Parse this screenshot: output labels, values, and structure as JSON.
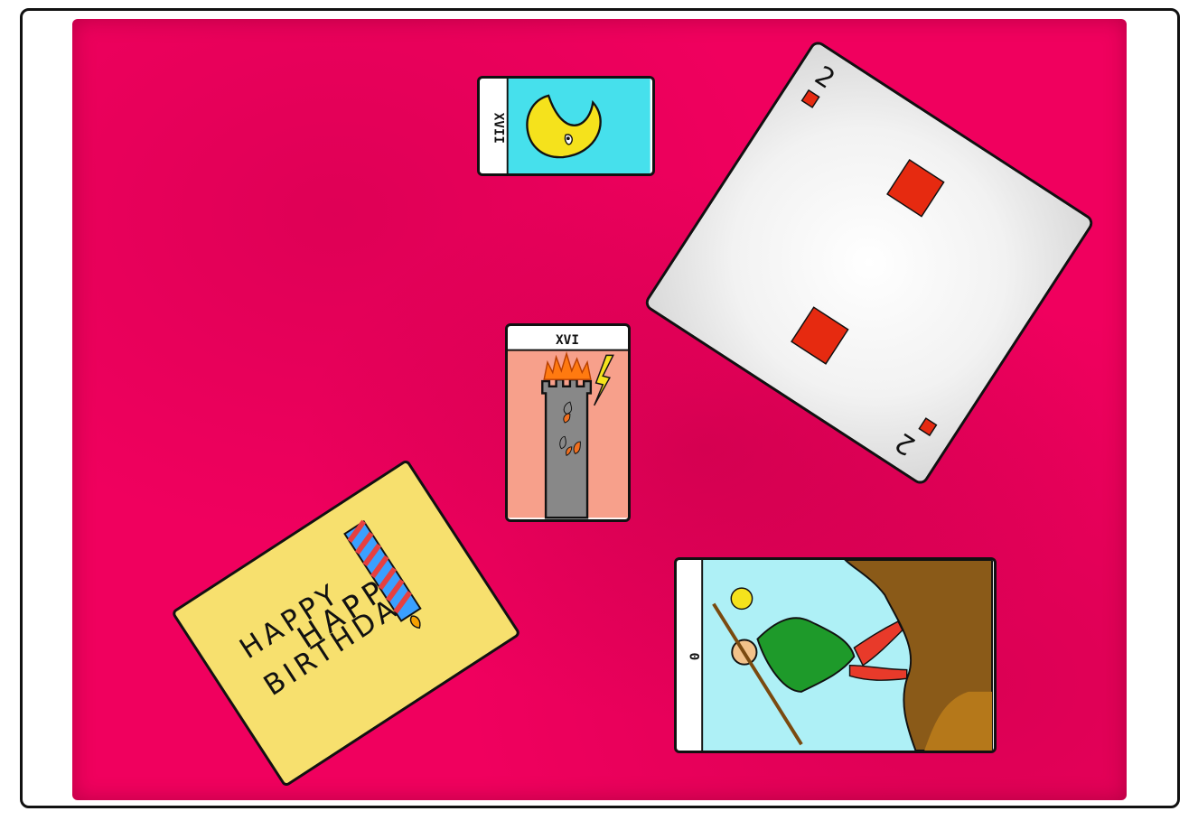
{
  "table": {
    "felt_color": "#f0005e"
  },
  "cards": {
    "moon": {
      "numeral": "XVII",
      "sky_color": "#46e0ec"
    },
    "tower": {
      "numeral": "XVI",
      "background_color": "#f7a08b"
    },
    "two_of_diamonds": {
      "rank": "2",
      "suit_color": "#e62a10"
    },
    "birthday": {
      "line1": "HAPPY",
      "line2": "BIRTHDAY",
      "card_color": "#f7e06e"
    },
    "fool": {
      "numeral": "0",
      "sky_color": "#aef0f6"
    }
  }
}
